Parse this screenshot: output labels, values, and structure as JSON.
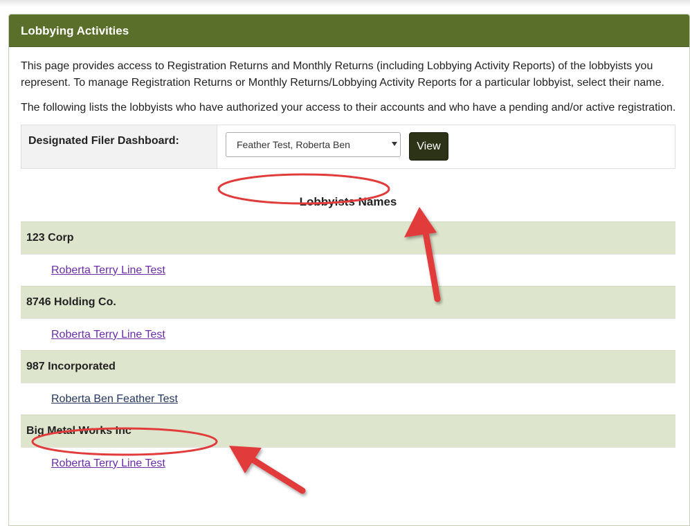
{
  "panel": {
    "title": "Lobbying Activities"
  },
  "intro": {
    "paragraph_1": "This page provides access to Registration Returns and Monthly Returns (including Lobbying Activity Reports) of the lobbyists you represent. To manage Registration Returns or Monthly Returns/Lobbying Activity Reports for a particular lobbyist, select their name.",
    "paragraph_2": "The following lists the lobbyists who have authorized your access to their accounts and who have a pending and/or active registration."
  },
  "filer": {
    "label": "Designated Filer Dashboard:",
    "selected_value": "Feather Test, Roberta Ben",
    "view_label": "View"
  },
  "lobbyists": {
    "title": "Lobbyists Names",
    "groups": [
      {
        "company": "123 Corp",
        "person": "Roberta Terry Line Test"
      },
      {
        "company": "8746 Holding Co.",
        "person": "Roberta Terry Line Test"
      },
      {
        "company": "987 Incorporated",
        "person": "Roberta Ben Feather Test"
      },
      {
        "company": "Big Metal Works Inc",
        "person": "Roberta Terry Line Test"
      }
    ]
  },
  "annotations": {
    "highlight_color": "#e23b3b"
  }
}
